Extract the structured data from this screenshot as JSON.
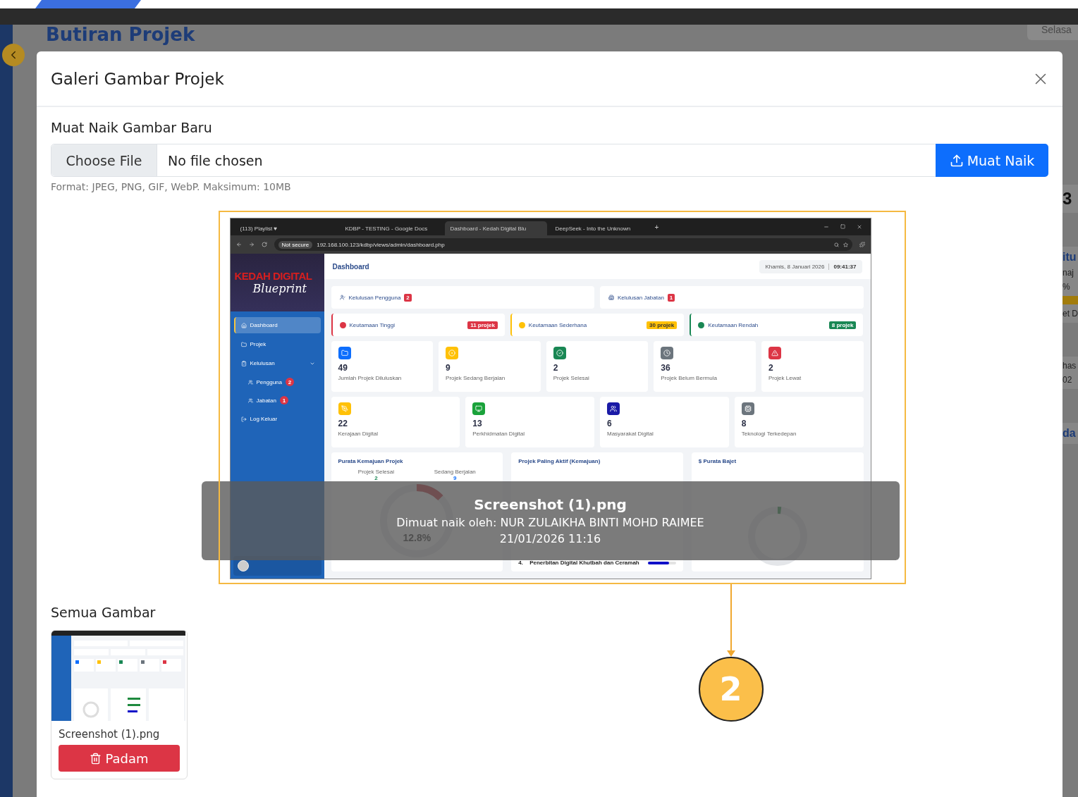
{
  "background_page": {
    "title": "Butiran Projek",
    "date_chip": "Selasa",
    "side_cards": [
      {
        "items": [
          {
            "kind": "number",
            "text": "3"
          }
        ]
      },
      {
        "items": [
          {
            "kind": "heading",
            "text": "itu"
          },
          {
            "kind": "text",
            "text": "naj"
          },
          {
            "kind": "text",
            "text": "%"
          },
          {
            "kind": "bar",
            "level": 1
          },
          {
            "kind": "text",
            "text": "et D"
          }
        ]
      },
      {
        "items": [
          {
            "kind": "text",
            "text": "has"
          },
          {
            "kind": "text",
            "text": "02"
          }
        ]
      },
      {
        "items": [
          {
            "kind": "heading",
            "text": "da"
          }
        ]
      }
    ]
  },
  "modal": {
    "title": "Galeri Gambar Projek",
    "upload": {
      "label": "Muat Naik Gambar Baru",
      "choose_button": "Choose File",
      "file_status": "No file chosen",
      "submit_button": "Muat Naik",
      "hint": "Format: JPEG, PNG, GIF, WebP. Maksimum: 10MB"
    },
    "preview": {
      "screenshot": {
        "browser": {
          "tabs": [
            {
              "title": "(113) Playlist ♥",
              "selected": false
            },
            {
              "title": "KDBP - TESTING - Google Docs",
              "selected": false
            },
            {
              "title": "Dashboard - Kedah Digital Blu",
              "selected": true
            },
            {
              "title": "DeepSeek - Into the Unknown",
              "selected": false
            }
          ],
          "new_tab": "+",
          "url_warning": "Not secure",
          "url": "192.168.100.123/kdbp/views/admin/dashboard.php"
        },
        "sidebar": {
          "logo_title": "KEDAH DIGITAL",
          "logo_script": "Blueprint",
          "nav": [
            {
              "label": "Dashboard",
              "selected": true
            },
            {
              "label": "Projek",
              "selected": false
            },
            {
              "label": "Kelulusan",
              "selected": false,
              "expanded": true,
              "children": [
                {
                  "label": "Pengguna",
                  "badge": "2",
                  "selected": false
                },
                {
                  "label": "Jabatan",
                  "badge": "1",
                  "selected": false
                }
              ]
            },
            {
              "label": "Log Keluar",
              "selected": false
            }
          ]
        },
        "header": {
          "title": "Dashboard",
          "date": "Khamis, 8 Januari 2026",
          "time": "09:41:37"
        },
        "approvals": [
          {
            "label": "Kelulusan Pengguna",
            "badge": "2"
          },
          {
            "label": "Kelulusan Jabatan",
            "badge": "1"
          }
        ],
        "priorities": [
          {
            "label": "Keutamaan Tinggi",
            "count": "11 projek",
            "color": "#dc3545"
          },
          {
            "label": "Keutamaan Sederhana",
            "count": "30 projek",
            "color": "#ffc107"
          },
          {
            "label": "Keutamaan Rendah",
            "count": "8 projek",
            "color": "#198754"
          }
        ],
        "status_stats": [
          {
            "value": "49",
            "label": "Jumlah Projek Diluluskan",
            "color": "#0d6efd"
          },
          {
            "value": "9",
            "label": "Projek Sedang Berjalan",
            "color": "#ffc107"
          },
          {
            "value": "2",
            "label": "Projek Selesai",
            "color": "#198754"
          },
          {
            "value": "36",
            "label": "Projek Belum Bermula",
            "color": "#6c757d"
          },
          {
            "value": "2",
            "label": "Projek Lewat",
            "color": "#dc3545"
          }
        ],
        "category_stats": [
          {
            "value": "22",
            "label": "Kerajaan Digital",
            "color": "#ffc107"
          },
          {
            "value": "13",
            "label": "Perkhidmatan Digital",
            "color": "#1aa23a"
          },
          {
            "value": "6",
            "label": "Masyarakat Digital",
            "color": "#1a1aa6"
          },
          {
            "value": "8",
            "label": "Teknologi Terkedepan",
            "color": "#6c757d"
          }
        ],
        "progress_panel": {
          "title": "Purata Kemajuan Projek",
          "items": [
            {
              "label": "Projek Selesai",
              "value": "2"
            },
            {
              "label": "Sedang Berjalan",
              "value": "9"
            }
          ],
          "level": 0.128,
          "percent": "12.8%"
        },
        "active_panel": {
          "title": "Projek Paling Aktif (Kemajuan)",
          "rows": [
            {
              "no": "4.",
              "name": "Penerbitan Digital Khutbah dan Ceramah",
              "level": 0.75
            }
          ]
        },
        "budget_panel": {
          "title": "$ Purata Bajet",
          "level": 0.02
        }
      },
      "caption": {
        "filename": "Screenshot (1).png",
        "uploader": "Dimuat naik oleh: NUR ZULAIKHA BINTI MOHD RAIMEE",
        "datetime": "21/01/2026 11:16"
      }
    },
    "gallery": {
      "title": "Semua Gambar",
      "items": [
        {
          "filename": "Screenshot (1).png",
          "delete_button": "Padam"
        }
      ]
    }
  },
  "annotation": {
    "step": "2"
  }
}
